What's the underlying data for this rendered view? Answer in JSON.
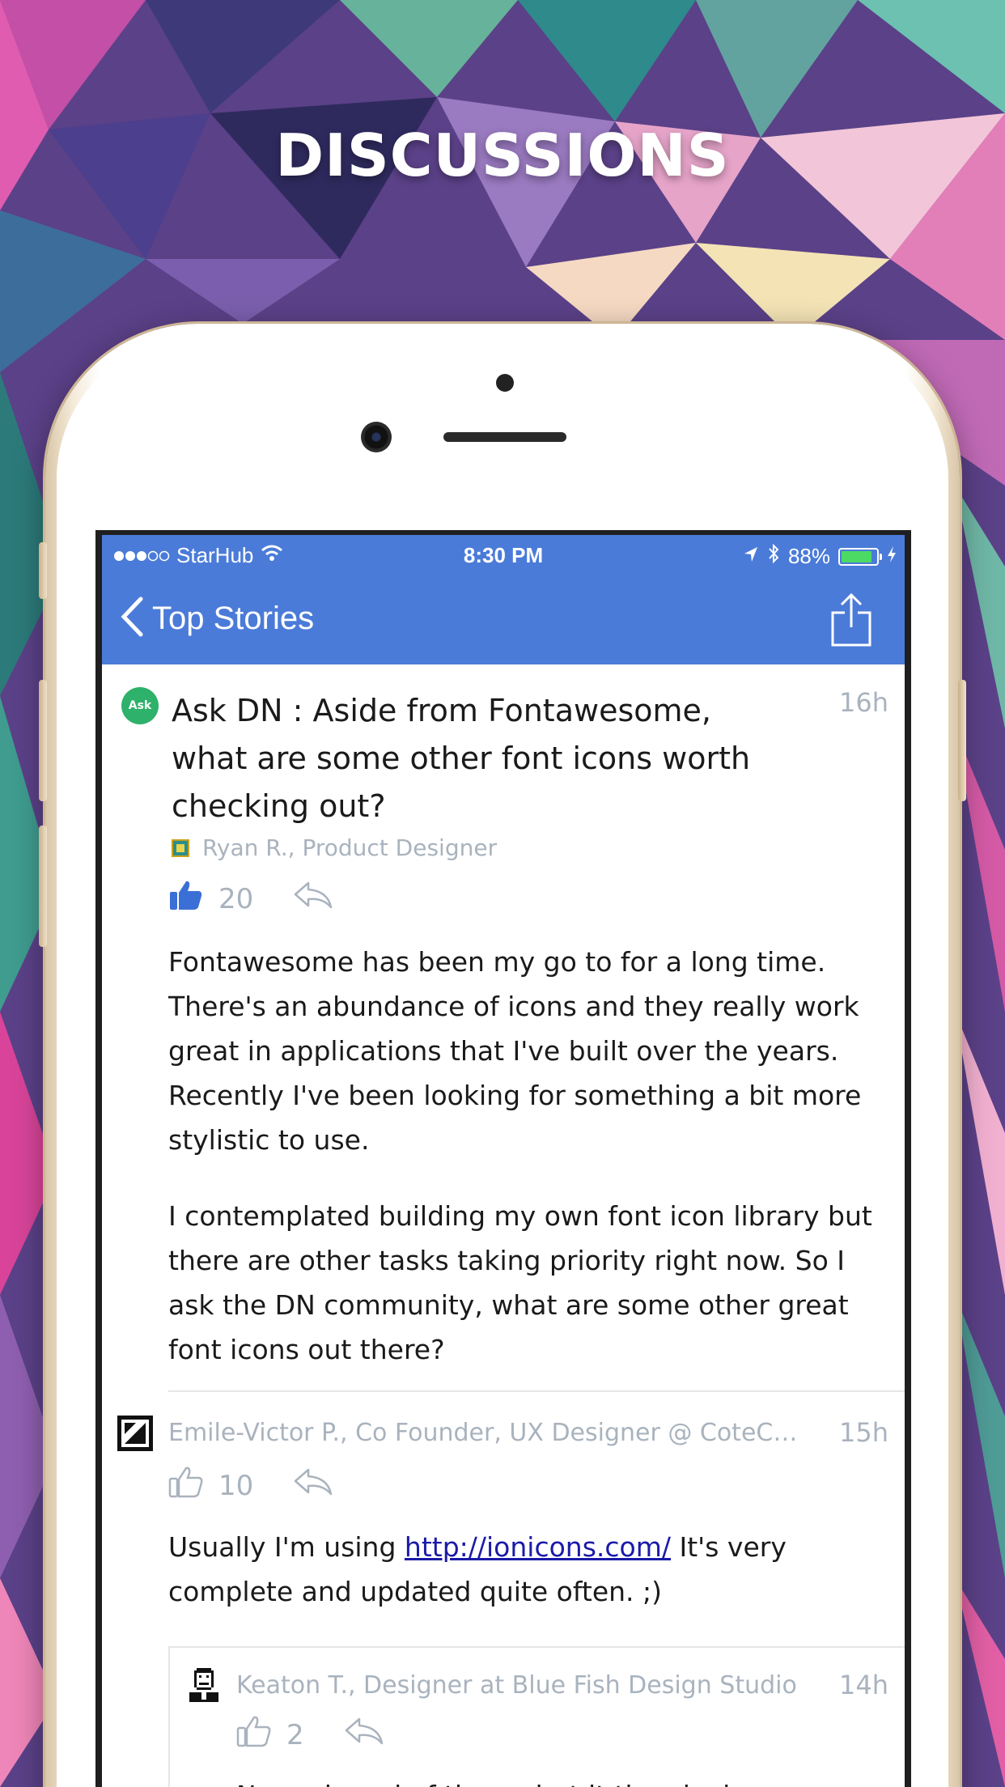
{
  "headline": "DISCUSSIONS",
  "colors": {
    "accent_blue": "#4b7bd8",
    "ask_badge_green": "#2eb16a",
    "meta_gray": "#a9b3be",
    "battery_green": "#4cd964"
  },
  "status_bar": {
    "signal_icon": "signal-dots-icon",
    "carrier": "StarHub",
    "wifi_icon": "wifi-icon",
    "time": "8:30 PM",
    "location_icon": "location-arrow-icon",
    "bluetooth_icon": "bluetooth-icon",
    "battery_percent": "88%",
    "battery_level": 0.88,
    "charging_icon": "bolt-icon"
  },
  "nav": {
    "back_label": "Top Stories",
    "back_icon": "chevron-left-icon",
    "share_icon": "share-icon"
  },
  "post": {
    "badge": "Ask",
    "title": "Ask DN : Aside from Fontawesome, what are some other font icons worth checking out?",
    "time": "16h",
    "author": "Ryan R., Product Designer",
    "upvotes": "20",
    "upvote_icon": "thumbs-up-filled-icon",
    "reply_icon": "reply-icon",
    "paragraphs": [
      "Fontawesome has been my go to for a long time. There's an abundance of icons and they really work great in applications that I've built over the years. Recently I've been looking for something a bit more stylistic to use.",
      "I contemplated building my own font icon library but there are other tasks taking priority right now. So I ask the DN community, what are some other great font icons out there?"
    ]
  },
  "comments": [
    {
      "author": "Emile-Victor P., Co Founder, UX Designer @ CoteC…",
      "time": "15h",
      "upvotes": "10",
      "text_before": "Usually I'm using ",
      "link": "http://ionicons.com/",
      "text_after": " It's very complete and updated quite often. ;)"
    },
    {
      "author": "Keaton T., Designer at Blue Fish Design Studio",
      "time": "14h",
      "upvotes": "2",
      "text_partial": "Never heard of these, but it they look"
    }
  ]
}
